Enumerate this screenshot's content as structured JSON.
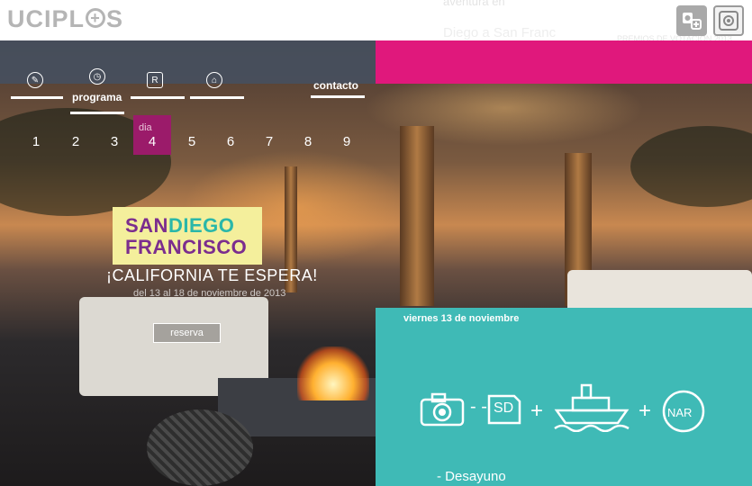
{
  "header": {
    "logo_text_left": "UCIPL",
    "logo_plus": "+",
    "logo_text_right": "S",
    "ghost_line_1": "aventura en",
    "ghost_line_2": "Diego a San Franc",
    "ghost_line_3": "PREMIOS DE VOTACION 2013",
    "icons": [
      "user-plus-icon",
      "settings-icon"
    ]
  },
  "nav": {
    "items": [
      {
        "icon": "pen-icon",
        "label": ""
      },
      {
        "icon": "clock-icon",
        "label": "programa"
      },
      {
        "icon": "logo-r-icon",
        "label": ""
      },
      {
        "icon": "home-icon",
        "label": ""
      },
      {
        "icon": "",
        "label": "contacto"
      }
    ]
  },
  "days": {
    "label": "dia",
    "selected": "4",
    "numbers": [
      "1",
      "2",
      "3",
      "4",
      "5",
      "6",
      "7",
      "8",
      "9"
    ]
  },
  "hero": {
    "san": "SAN",
    "diego": "DIEGO",
    "francisco": "FRANCISCO",
    "tagline": "¡CALIFORNIA TE ESPERA!",
    "dates": "del 13 al 18 de noviembre de 2013",
    "reserve_button": "reserva"
  },
  "day_panel": {
    "date": "viernes 13 de noviembre",
    "items": [
      "camera-icon",
      "SD",
      "ship-icon",
      "NAR"
    ],
    "first_activity": "- Desayuno"
  },
  "colors": {
    "pink": "#e0187c",
    "teal": "#3fbab6",
    "day_highlight": "#9b1b6a",
    "card_yellow": "#f4ef9c"
  }
}
